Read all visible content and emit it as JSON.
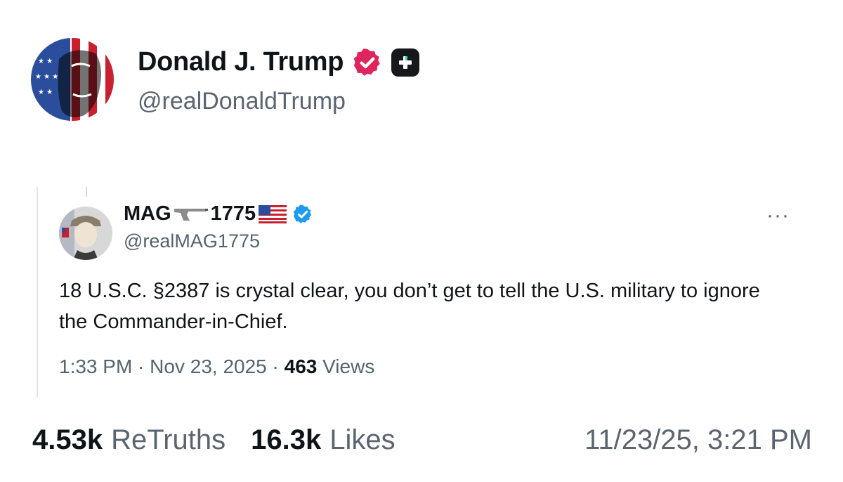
{
  "post": {
    "author": {
      "name": "Donald J. Trump",
      "handle": "@realDonaldTrump",
      "verified_icon": "verified-badge-icon",
      "verified_color": "#e0245e",
      "platform_badge_icon": "plus-badge-icon"
    },
    "quoted": {
      "name_prefix": "MAG",
      "name_suffix": "1775",
      "gun_icon": "pistol-icon",
      "flag_icon": "us-flag-icon",
      "verified_color": "#1d9bf0",
      "handle": "@realMAG1775",
      "more_label": "···",
      "text": "18 U.S.C. §2387 is crystal clear, you don’t get to tell the U.S. military to ignore the Commander-in-Chief.",
      "time": "1:33 PM",
      "sep1": " · ",
      "date": "Nov 23, 2025",
      "sep2": " · ",
      "views_count": "463",
      "views_label": " Views"
    },
    "stats": {
      "retruths_count": "4.53k",
      "retruths_label": "ReTruths",
      "likes_count": "16.3k",
      "likes_label": "Likes",
      "timestamp": "11/23/25, 3:21 PM"
    }
  }
}
